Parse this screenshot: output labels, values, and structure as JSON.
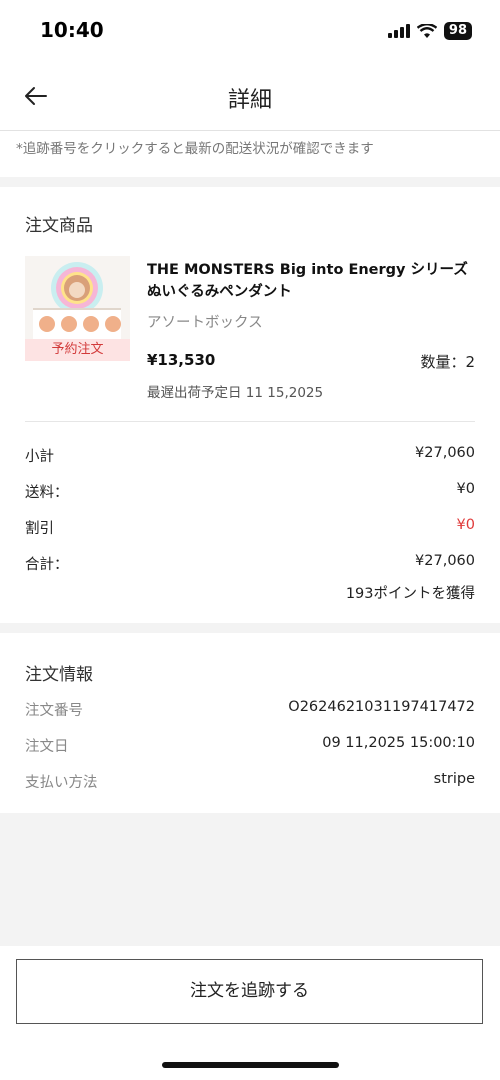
{
  "status_bar": {
    "time": "10:40",
    "battery": "98"
  },
  "header": {
    "title": "詳細"
  },
  "notice": "*追跡番号をクリックすると最新の配送状況が確認できます",
  "products": {
    "section_title": "注文商品",
    "item": {
      "badge": "予約注文",
      "name": "THE MONSTERS Big into Energy シリーズ ぬいぐるみペンダント",
      "variant": "アソートボックス",
      "price": "¥13,530",
      "quantity": "数量：2",
      "ship_date": "最遅出荷予定日 11 15,2025"
    },
    "summary": [
      {
        "label": "小計",
        "value": "¥27,060"
      },
      {
        "label": "送料：",
        "value": "¥0"
      },
      {
        "label": "割引",
        "value": "¥0"
      },
      {
        "label": "合計：",
        "value": "¥27,060"
      }
    ],
    "points": "193ポイントを獲得"
  },
  "order_info": {
    "title": "注文情報",
    "rows": [
      {
        "label": "注文番号",
        "value": "O2624621031197417472"
      },
      {
        "label": "注文日",
        "value": "09 11,2025 15:00:10"
      },
      {
        "label": "支払い方法",
        "value": "stripe"
      }
    ]
  },
  "footer": {
    "track_button": "注文を追跡する"
  },
  "colors": {
    "discount": "#e03a3a",
    "badge_text": "#d23a3a",
    "badge_bg": "#fde2e2"
  }
}
